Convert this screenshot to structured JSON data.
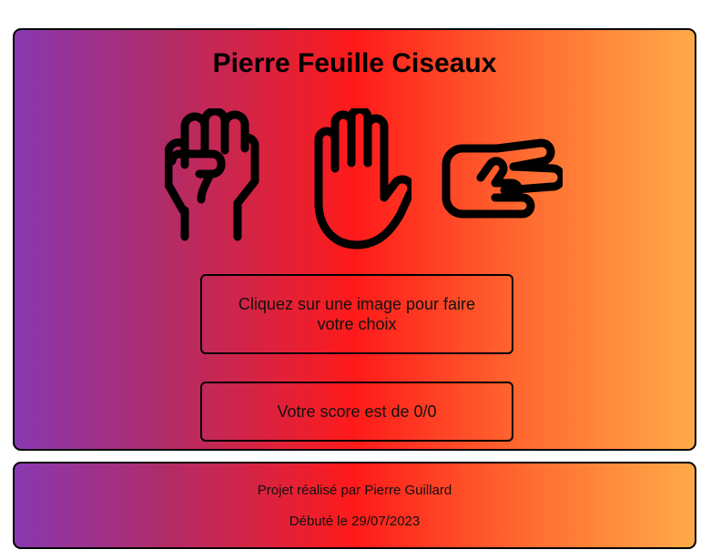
{
  "game": {
    "title": "Pierre Feuille Ciseaux",
    "choices": [
      {
        "id": "rock",
        "icon": "fist-icon"
      },
      {
        "id": "paper",
        "icon": "open-hand-icon"
      },
      {
        "id": "scissors",
        "icon": "scissors-hand-icon"
      }
    ],
    "message": "Cliquez sur une image pour faire votre choix",
    "score_text": "Votre score est de 0/0"
  },
  "footer": {
    "author": "Projet réalisé par Pierre Guillard",
    "started": "Débuté le 29/07/2023"
  },
  "colors": {
    "gradient": [
      "#8a38b0",
      "#b02c68",
      "#ff1a1a",
      "#ff6a30",
      "#ffaa48"
    ],
    "border": "#000000"
  }
}
